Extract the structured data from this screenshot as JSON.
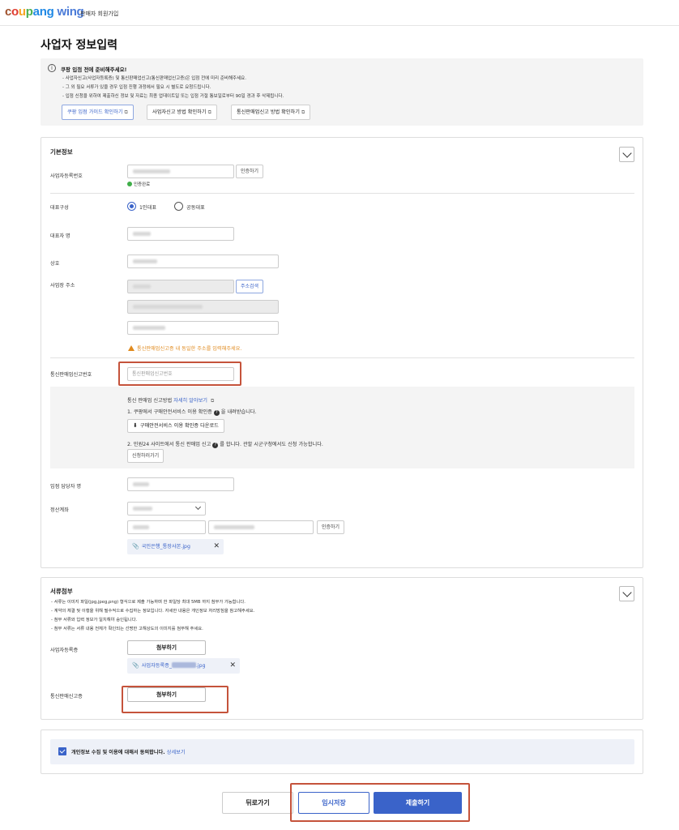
{
  "header": {
    "logo_parts": [
      "c",
      "o",
      "u",
      "p",
      "ang"
    ],
    "logo_wing": "wing",
    "subtitle": "판매자 회원가입"
  },
  "page_title": "사업자 정보입력",
  "notice": {
    "title": "쿠팡 입점 전에 준비해주세요!",
    "lines": [
      "- 사업자신고(사업자등록증) 및 통신판매업신고(통신판매업신고증)은 입점 전에 미리 준비해주세요.",
      "- 그 외 필요 서류가 있을 경우 입점 진행 과정에서 필요 시 별도로 요청드립니다.",
      "- 입점 신청을 위하여 제출하신 정보 및 자료는 최종 업데이트일 또는 입점 거절 통보일로부터 90일 경과 후 삭제됩니다."
    ],
    "buttons": [
      "쿠팡 입점 가이드 확인하기",
      "사업자신고 방법 확인하기",
      "통신판매업신고 방법 확인하기"
    ]
  },
  "basic": {
    "section_title": "기본정보",
    "biz_number_label": "사업자등록번호",
    "verify_label": "인증하기",
    "verified_note": "인증완료",
    "rep_type_label": "대표구성",
    "rep_single": "1인대표",
    "rep_joint": "공동대표",
    "rep_name_label": "대표자 명",
    "company_label": "상호",
    "address_label": "사업장 주소",
    "address_search": "주소검색",
    "address_warning": "통신판매업신고증 내 동일한 주소를 입력해주세요.",
    "ecommerce_label": "통신판매업신고번호",
    "ecommerce_placeholder": "통신판매업신고번호",
    "guide_title": "통신 판매업 신고방법",
    "guide_link": "자세히 알아보기",
    "guide_step1_a": "1. 쿠팡에서 구매안전서비스 이용 확인증",
    "guide_step1_b": "을 내려받습니다.",
    "download_button": "구매안전서비스 이용 확인증 다운로드",
    "guide_step2_a": "2. 민원24 사이트에서 통신 판매업 신고",
    "guide_step2_b": "를 합니다. 관할 시군구청에서도 신청 가능합니다.",
    "apply_button": "신청하러가기",
    "manager_label": "입점 담당자 명",
    "account_label": "정산계좌",
    "account_verify": "인증하기",
    "bankbook_file": "국민은행_통장사본.jpg"
  },
  "documents": {
    "section_title": "서류첨부",
    "notes": [
      "- 서류는 이미지 파일(jpg,jpeg,png) 형식으로 제출 가능하며 한 파일당 최대 5MB 까지 첨부가 가능합니다.",
      "- 계약의 체결 및 이행을 위해 필수적으로 수집하는 정보입니다. 자세한 내용은 개인정보 처리방침을 참고해주세요.",
      "- 첨부 서류와 입력 정보가 일치해야 승인됩니다.",
      "- 첨부 서류는 서류 내용 전체가 확인되는 선명한 고해상도의 이미지를 첨부해 주세요."
    ],
    "biz_cert_label": "사업자등록증",
    "attach_label": "첨부하기",
    "biz_cert_file_prefix": "사업자등록증_",
    "biz_cert_file_suffix": ".jpg",
    "ecommerce_cert_label": "통신판매신고증",
    "attach_label_2": "첨부하기"
  },
  "consent": {
    "text": "개인정보 수집 및 이용에 대해서 동의합니다.",
    "link": "상세보기"
  },
  "footer": {
    "back": "뒤로가기",
    "save_draft": "임시저장",
    "submit": "제출하기"
  },
  "colors": {
    "accent": "#3a63c9",
    "highlight": "#c5533b",
    "warning": "#e08a1e",
    "success": "#3fae49"
  }
}
